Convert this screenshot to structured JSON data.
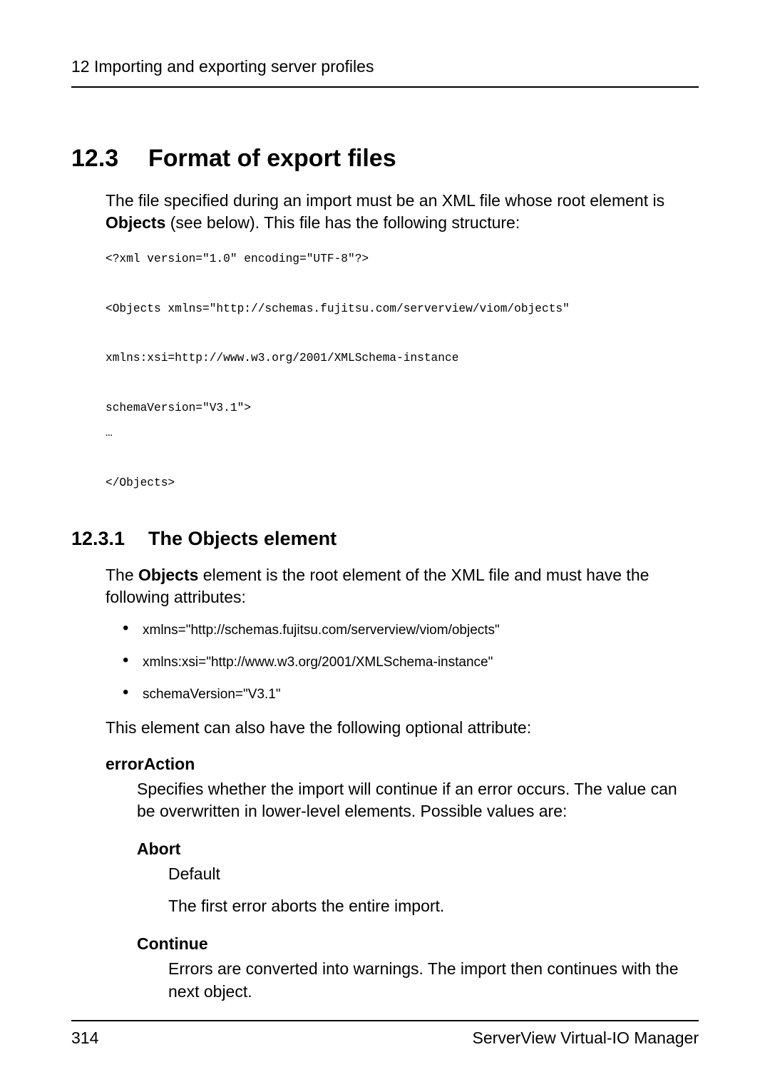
{
  "header": {
    "running": "12 Importing and exporting server profiles"
  },
  "section": {
    "number": "12.3",
    "title": "Format of export files",
    "intro_pre": "The file specified during an import must be an XML file whose root element is ",
    "intro_bold": "Objects",
    "intro_post": " (see below). This file has the following structure:",
    "code": "<?xml version=\"1.0\" encoding=\"UTF-8\"?>\n\n<Objects xmlns=\"http://schemas.fujitsu.com/serverview/viom/objects\"\n\nxmlns:xsi=http://www.w3.org/2001/XMLSchema-instance\n\nschemaVersion=\"V3.1\">\n…\n\n</Objects>"
  },
  "subsection": {
    "number": "12.3.1",
    "title": "The Objects element",
    "intro_pre": "The ",
    "intro_bold": "Objects",
    "intro_post": " element is the root element of the XML file and must have the following attributes:",
    "bullets": [
      "xmlns=\"http://schemas.fujitsu.com/serverview/viom/objects\"",
      "xmlns:xsi=\"http://www.w3.org/2001/XMLSchema-instance\"",
      "schemaVersion=\"V3.1\""
    ],
    "optional_intro": "This element can also have the following optional attribute:",
    "errorAction": {
      "term": "errorAction",
      "desc": "Specifies whether the import will continue if an error occurs. The value can be overwritten in lower-level elements. Possible values are:",
      "options": {
        "abort": {
          "term": "Abort",
          "line1": "Default",
          "line2": "The first error aborts the entire import."
        },
        "continue": {
          "term": "Continue",
          "line1": "Errors are converted into warnings. The import then continues with the next object."
        }
      }
    }
  },
  "footer": {
    "page": "314",
    "product": "ServerView Virtual-IO Manager"
  }
}
